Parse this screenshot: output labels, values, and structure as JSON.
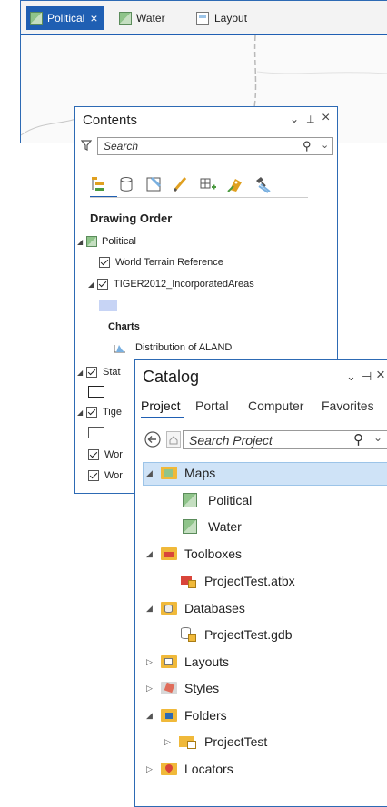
{
  "map_view": {
    "tabs": [
      {
        "label": "Political",
        "active": true,
        "close": "×"
      },
      {
        "label": "Water",
        "active": false
      },
      {
        "label": "Layout",
        "active": false
      }
    ]
  },
  "contents": {
    "title": "Contents",
    "controls": {
      "dropdown": "⌄",
      "pin": "⊥",
      "close": "×"
    },
    "search_placeholder": "Search",
    "section_header": "Drawing Order",
    "rows": {
      "political": "Political",
      "world_terrain": "World Terrain Reference",
      "tiger_incorporated": "TIGER2012_IncorporatedAreas",
      "charts_header": "Charts",
      "chart_item": "Distribution of ALAND",
      "states": "Stat",
      "tiger2": "Tige",
      "world1": "Wor",
      "world2": "Wor"
    }
  },
  "catalog": {
    "title": "Catalog",
    "controls": {
      "dropdown": "⌄",
      "pin": "⊣",
      "close": "×"
    },
    "tabs": [
      "Project",
      "Portal",
      "Computer",
      "Favorites"
    ],
    "search_placeholder": "Search Project",
    "tree": {
      "maps": "Maps",
      "political": "Political",
      "water": "Water",
      "toolboxes": "Toolboxes",
      "toolbox_item": "ProjectTest.atbx",
      "databases": "Databases",
      "database_item": "ProjectTest.gdb",
      "layouts": "Layouts",
      "styles": "Styles",
      "folders": "Folders",
      "folder_item": "ProjectTest",
      "locators": "Locators"
    }
  },
  "colors": {
    "accent": "#1f5fb3",
    "selected_row": "#cfe3f7",
    "folder": "#f0b93a"
  }
}
